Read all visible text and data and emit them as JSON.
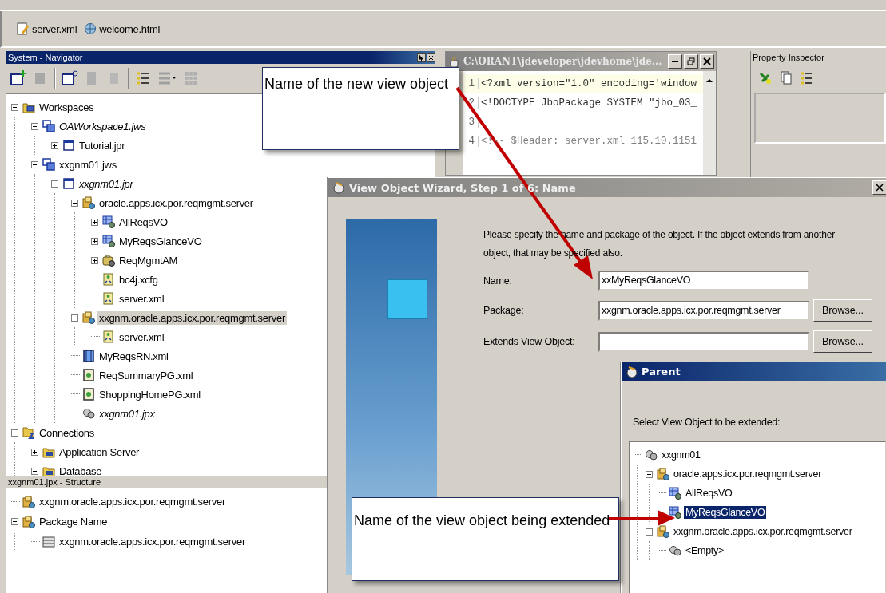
{
  "tab_bar": {
    "tabs": [
      {
        "label": "server.xml",
        "kind": "xml"
      },
      {
        "label": "welcome.html",
        "kind": "html"
      }
    ]
  },
  "navigator": {
    "title": "System - Navigator",
    "tree": [
      {
        "label": "Workspaces",
        "kind": "workspaces",
        "expanded": true,
        "selected": false,
        "children": [
          {
            "label": "OAWorkspace1.jws",
            "kind": "workspace",
            "italic": true,
            "expanded": true,
            "selected": false,
            "children": [
              {
                "label": "Tutorial.jpr",
                "kind": "project",
                "expanded": false,
                "selected": false
              }
            ]
          },
          {
            "label": "xxgnm01.jws",
            "kind": "workspace",
            "expanded": true,
            "selected": false,
            "children": [
              {
                "label": "xxgnm01.jpr",
                "kind": "project",
                "italic": true,
                "expanded": true,
                "selected": false,
                "children": [
                  {
                    "label": "oracle.apps.icx.por.reqmgmt.server",
                    "kind": "package",
                    "expanded": true,
                    "selected": false,
                    "children": [
                      {
                        "label": "AllReqsVO",
                        "kind": "view-object",
                        "expanded": false,
                        "selected": false
                      },
                      {
                        "label": "MyReqsGlanceVO",
                        "kind": "view-object",
                        "expanded": false,
                        "selected": false
                      },
                      {
                        "label": "ReqMgmtAM",
                        "kind": "app-module",
                        "expanded": false,
                        "selected": false
                      },
                      {
                        "label": "bc4j.xcfg",
                        "kind": "config",
                        "selected": false
                      },
                      {
                        "label": "server.xml",
                        "kind": "config",
                        "selected": false
                      }
                    ]
                  },
                  {
                    "label": "xxgnm.oracle.apps.icx.por.reqmgmt.server",
                    "kind": "package",
                    "expanded": true,
                    "selected": true,
                    "children": [
                      {
                        "label": "server.xml",
                        "kind": "config",
                        "selected": false
                      }
                    ]
                  },
                  {
                    "label": "MyReqsRN.xml",
                    "kind": "region",
                    "selected": false
                  },
                  {
                    "label": "ReqSummaryPG.xml",
                    "kind": "page",
                    "selected": false
                  },
                  {
                    "label": "ShoppingHomePG.xml",
                    "kind": "page",
                    "selected": false
                  },
                  {
                    "label": "xxgnm01.jpx",
                    "kind": "jpx",
                    "italic": true,
                    "selected": false
                  }
                ]
              }
            ]
          }
        ]
      },
      {
        "label": "Connections",
        "kind": "connections",
        "expanded": true,
        "selected": false,
        "children": [
          {
            "label": "Application Server",
            "kind": "server-folder",
            "expanded": false,
            "selected": false
          },
          {
            "label": "Database",
            "kind": "server-folder",
            "expanded": true,
            "selected": false
          }
        ]
      }
    ]
  },
  "structure": {
    "title": "xxgnm01.jpx - Structure",
    "tree": [
      {
        "label": "xxgnm.oracle.apps.icx.por.reqmgmt.server",
        "kind": "package"
      },
      {
        "label": "Package Name",
        "kind": "package",
        "expanded": true,
        "children": [
          {
            "label": "xxgnm.oracle.apps.icx.por.reqmgmt.server",
            "kind": "package-def"
          }
        ]
      }
    ]
  },
  "editor": {
    "title": "C:\\ORANT\\jdeveloper\\jdevhome\\jde...",
    "lines": [
      {
        "number": "1",
        "text": "<?xml version=\"1.0\" encoding='window",
        "kind": "markup"
      },
      {
        "number": "2",
        "text": "<!DOCTYPE JboPackage SYSTEM \"jbo_03_",
        "kind": "markup"
      },
      {
        "number": "3"
      },
      {
        "number": "4",
        "text": "<!-- $Header: server.xml 115.10.1151",
        "kind": "comment"
      }
    ]
  },
  "property_inspector": {
    "title": "Property Inspector"
  },
  "wizard": {
    "title": "View Object Wizard, Step 1 of 6: Name",
    "description": "Please specify the name and package of the object.  If the object extends from another object, that may be specified also.",
    "fields": [
      {
        "label": "Name:",
        "value": "xxMyReqsGlanceVO"
      },
      {
        "label": "Package:",
        "value": "xxgnm.oracle.apps.icx.por.reqmgmt.server",
        "button": "Browse..."
      },
      {
        "label": "Extends View Object:",
        "button": "Browse..."
      }
    ]
  },
  "parent_dialog": {
    "title": "Parent",
    "prompt": "Select View Object to be extended:",
    "tree": [
      {
        "label": "xxgnm01",
        "kind": "jpx",
        "selected": false,
        "children": [
          {
            "label": "oracle.apps.icx.por.reqmgmt.server",
            "kind": "package",
            "expanded": true,
            "selected": false,
            "children": [
              {
                "label": "AllReqsVO",
                "kind": "view-object",
                "selected": false
              },
              {
                "label": "MyReqsGlanceVO",
                "kind": "view-object",
                "selected": true
              }
            ]
          },
          {
            "label": "xxgnm.oracle.apps.icx.por.reqmgmt.server",
            "kind": "package",
            "expanded": true,
            "selected": false,
            "children": [
              {
                "label": "<Empty>",
                "kind": "jpx",
                "selected": false
              }
            ]
          }
        ]
      }
    ]
  },
  "callouts": [
    {
      "text": "Name of the new view object"
    },
    {
      "text": "Name of the view object being extended"
    }
  ]
}
